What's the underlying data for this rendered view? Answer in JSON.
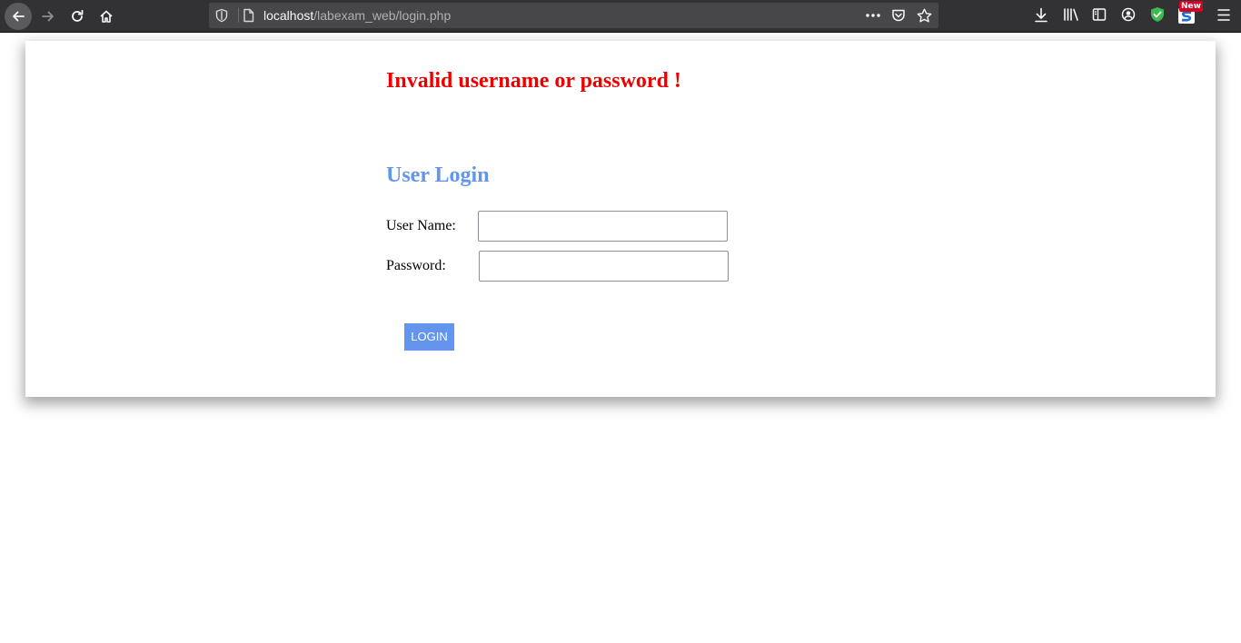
{
  "browser": {
    "url_host": "localhost",
    "url_path": "/labexam_web/login.php",
    "badge_label": "New",
    "icons": [
      "back-icon",
      "forward-icon",
      "reload-icon",
      "home-icon",
      "shield-icon",
      "page-icon",
      "more-icon",
      "pocket-icon",
      "bookmark-star-icon",
      "download-icon",
      "library-icon",
      "sidebar-icon",
      "account-icon",
      "extension-shield-icon",
      "extension-s-icon",
      "menu-icon"
    ]
  },
  "page": {
    "error_message": "Invalid username or password !",
    "title": "User Login",
    "username_label": "User Name:",
    "username_value": "",
    "password_label": "Password:",
    "password_value": "",
    "login_button": "LOGIN"
  },
  "colors": {
    "error": "#ee0000",
    "accent": "#6495ed",
    "toolbar": "#323234"
  }
}
